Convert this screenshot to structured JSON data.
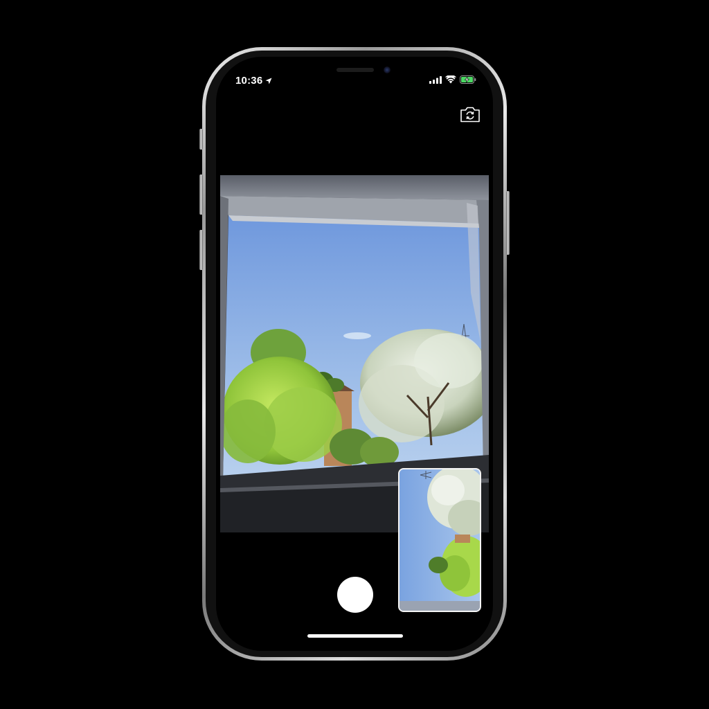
{
  "status_bar": {
    "time": "10:36",
    "location_icon": "location-arrow-icon",
    "signal_icon": "cellular-signal-icon",
    "wifi_icon": "wifi-icon",
    "battery_icon": "battery-charging-icon",
    "battery_accent": "#4cd964"
  },
  "camera": {
    "flip_icon": "camera-flip-icon",
    "shutter_icon": "shutter-button",
    "main_preview": "rear-camera-preview",
    "pip_preview": "secondary-camera-preview"
  },
  "colors": {
    "background": "#000000",
    "sky": "#9cbce8",
    "foliage_light": "#a8d84a",
    "foliage_white": "#dfe6d8",
    "shutter": "#ffffff"
  }
}
